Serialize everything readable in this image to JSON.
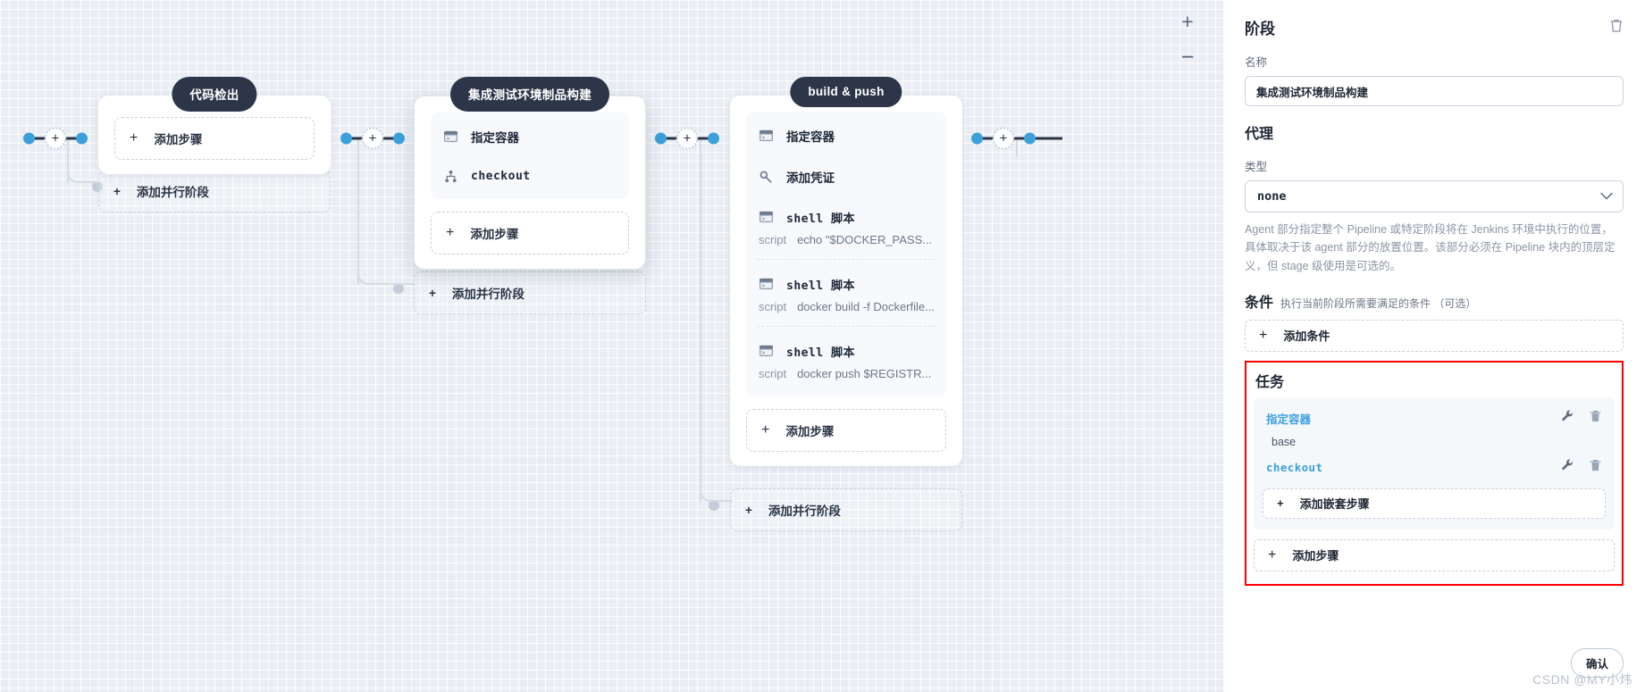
{
  "canvas": {
    "zoom_in": "+",
    "zoom_out": "−",
    "plus_glyph": "+",
    "add_parallel_label": "添加并行阶段",
    "add_step_label": "添加步骤",
    "script_key": "script",
    "stages": [
      {
        "name": "代码检出",
        "steps": [],
        "add_step": "添加步骤",
        "add_parallel": "添加并行阶段"
      },
      {
        "name": "集成测试环境制品构建",
        "steps": [
          {
            "icon": "terminal-icon",
            "label": "指定容器",
            "script": null
          },
          {
            "icon": "git-branch-icon",
            "label": "checkout",
            "script": null
          }
        ],
        "add_step": "添加步骤",
        "add_parallel": "添加并行阶段"
      },
      {
        "name": "build & push",
        "steps": [
          {
            "icon": "terminal-icon",
            "label": "指定容器",
            "script": null
          },
          {
            "icon": "key-icon",
            "label": "添加凭证",
            "script": null
          },
          {
            "icon": "terminal-icon",
            "label": "shell 脚本",
            "script": "echo \"$DOCKER_PASS..."
          },
          {
            "icon": "terminal-icon",
            "label": "shell 脚本",
            "script": "docker build -f Dockerfile..."
          },
          {
            "icon": "terminal-icon",
            "label": "shell 脚本",
            "script": "docker push $REGISTR..."
          }
        ],
        "add_step": "添加步骤",
        "add_parallel": "添加并行阶段"
      }
    ]
  },
  "panel": {
    "title": "阶段",
    "delete_icon": "trash-icon",
    "name_label": "名称",
    "name_value": "集成测试环境制品构建",
    "agent_heading": "代理",
    "type_label": "类型",
    "agent_type_value": "none",
    "agent_help": "Agent 部分指定整个 Pipeline 或特定阶段将在 Jenkins 环境中执行的位置，具体取决于该 agent 部分的放置位置。该部分必须在 Pipeline 块内的顶层定义，但 stage 级使用是可选的。",
    "condition_heading": "条件",
    "condition_sub": "执行当前阶段所需要满足的条件 （可选）",
    "add_condition_label": "添加条件",
    "tasks_heading": "任务",
    "tasks": [
      {
        "label": "指定容器",
        "mono": false,
        "sub": "base",
        "wrench": "wrench-icon",
        "trash": "trash-icon"
      },
      {
        "label": "checkout",
        "mono": true,
        "sub": null,
        "wrench": "wrench-icon",
        "trash": "trash-icon"
      }
    ],
    "add_nested_step_label": "添加嵌套步骤",
    "add_step_label": "添加步骤",
    "confirm_label": "确认",
    "plus_glyph": "+",
    "highlight_color": "#ff0000",
    "accent_color": "#3b9fe0"
  },
  "watermark": "CSDN @MY小炜"
}
